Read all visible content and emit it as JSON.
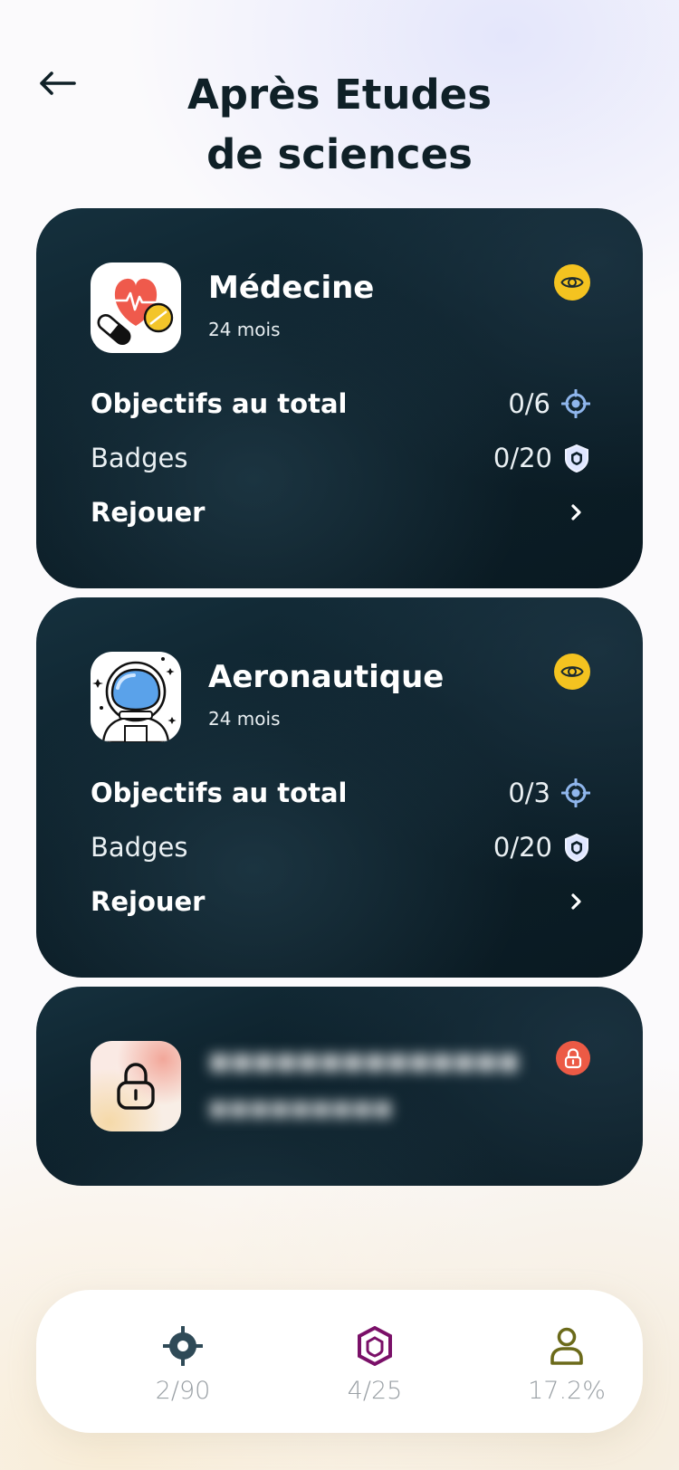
{
  "header": {
    "title_line1": "Après Etudes",
    "title_line2": "de sciences"
  },
  "cards": [
    {
      "name": "Médecine",
      "duration": "24 mois",
      "objectives_label": "Objectifs au total",
      "objectives_value": "0/6",
      "badges_label": "Badges",
      "badges_value": "0/20",
      "replay_label": "Rejouer",
      "icon": "medicine-icon",
      "status": "unlocked"
    },
    {
      "name": "Aeronautique",
      "duration": "24 mois",
      "objectives_label": "Objectifs au total",
      "objectives_value": "0/3",
      "badges_label": "Badges",
      "badges_value": "0/20",
      "replay_label": "Rejouer",
      "icon": "astronaut-icon",
      "status": "unlocked"
    },
    {
      "name": "",
      "duration": "",
      "icon": "padlock-icon",
      "status": "locked"
    }
  ],
  "stats": {
    "objectives": "2/90",
    "badges": "4/25",
    "progress": "17.2%"
  },
  "colors": {
    "card_bg": "#0c1f29",
    "eye_badge": "#f4c320",
    "lock_badge": "#ec5a45",
    "target_blue": "#8fb6ec",
    "title": "#0f2027",
    "stat_objectives": "#2f4a57",
    "stat_badges": "#7a1068",
    "stat_profile": "#6b6a1a"
  }
}
